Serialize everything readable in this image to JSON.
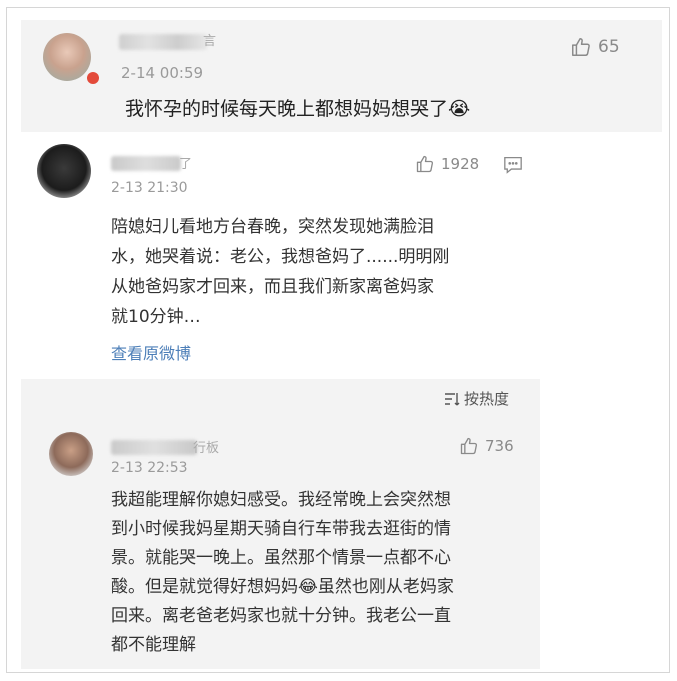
{
  "comments": [
    {
      "time": "2-14 00:59",
      "likes": "65",
      "text": "我怀孕的时候每天晚上都想妈妈想哭了😭",
      "name_fragment": "言"
    },
    {
      "time": "2-13 21:30",
      "likes": "1928",
      "text": "陪媳妇儿看地方台春晚，突然发现她满脸泪\n水，她哭着说：老公，我想爸妈了......明明刚\n从她爸妈家才回来，而且我们新家离爸妈家\n就10分钟…",
      "name_fragment": "了"
    },
    {
      "time": "2-13 22:53",
      "likes": "736",
      "text": "我超能理解你媳妇感受。我经常晚上会突然想\n到小时候我妈星期天骑自行车带我去逛街的情\n景。就能哭一晚上。虽然那个情景一点都不心\n酸。但是就觉得好想妈妈😂虽然也刚从老妈家\n回来。离老爸老妈家也就十分钟。我老公一直\n都不能理解",
      "name_fragment": "行板"
    }
  ],
  "view_original_label": "查看原微博",
  "sort_label": "按热度",
  "icons": [
    "thumbs-up-icon",
    "comment-icon",
    "sort-icon"
  ],
  "colors": {
    "link": "#4d7fb8",
    "meta": "#9a9a9a",
    "panel": "#f3f3f3"
  }
}
